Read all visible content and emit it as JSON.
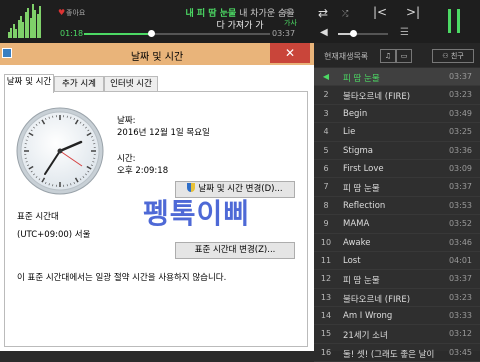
{
  "player": {
    "like_label": "좋아요",
    "lyric_line1_highlight": "내 피 땀 눈물",
    "lyric_line1_rest": " 내 차가운 숨을",
    "lyric_line2": "다 가져가 가",
    "eq_label": "EQ",
    "lyrics_label": "가사",
    "current_time": "01:18",
    "total_time": "03:37",
    "progress_fraction": 0.36,
    "volume_fraction": 0.3,
    "repeat_label": "⇄",
    "accent_color": "#4cd964"
  },
  "dialog": {
    "title": "날짜 및 시간",
    "close_label": "✕",
    "tabs": [
      "날짜 및 시간",
      "추가 시계",
      "인터넷 시간"
    ],
    "date_label": "날짜:",
    "date_value": "2016년 12월 1일 목요일",
    "time_label": "시간:",
    "time_value": "오후 2:09:18",
    "change_datetime_button": "날짜 및 시간 변경(D)...",
    "timezone_heading": "표준 시간대",
    "timezone_value": "(UTC+09:00) 서울",
    "change_timezone_button": "표준 시간대 변경(Z)...",
    "dst_note": "이 표준 시간대에서는 일광 절약 시간을 사용하지 않습니다.",
    "watermark": "펭톡이삐"
  },
  "playlist": {
    "header_title": "현재재생목록",
    "friend_button": "친구",
    "rows": [
      {
        "num": "",
        "name": "피 땀 눈물",
        "dur": "03:37"
      },
      {
        "num": "2",
        "name": "불타오르네 (FIRE)",
        "dur": "03:23"
      },
      {
        "num": "3",
        "name": "Begin",
        "dur": "03:49"
      },
      {
        "num": "4",
        "name": "Lie",
        "dur": "03:25"
      },
      {
        "num": "5",
        "name": "Stigma",
        "dur": "03:36"
      },
      {
        "num": "6",
        "name": "First Love",
        "dur": "03:09"
      },
      {
        "num": "7",
        "name": "피 땀 눈물",
        "dur": "03:37"
      },
      {
        "num": "8",
        "name": "Reflection",
        "dur": "03:53"
      },
      {
        "num": "9",
        "name": "MAMA",
        "dur": "03:52"
      },
      {
        "num": "10",
        "name": "Awake",
        "dur": "03:46"
      },
      {
        "num": "11",
        "name": "Lost",
        "dur": "04:01"
      },
      {
        "num": "12",
        "name": "피 땀 눈물",
        "dur": "03:37"
      },
      {
        "num": "13",
        "name": "불타오르네 (FIRE)",
        "dur": "03:23"
      },
      {
        "num": "14",
        "name": "Am I Wrong",
        "dur": "03:33"
      },
      {
        "num": "15",
        "name": "21세기 소녀",
        "dur": "03:12"
      },
      {
        "num": "16",
        "name": "둘! 셋! (그래도 좋은 날이",
        "dur": "03:45"
      }
    ]
  }
}
